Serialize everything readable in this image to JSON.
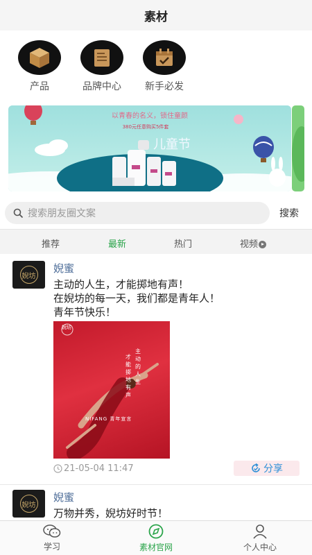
{
  "header": {
    "title": "素材"
  },
  "categories": [
    {
      "label": "产品",
      "icon": "box-icon"
    },
    {
      "label": "品牌中心",
      "icon": "document-icon"
    },
    {
      "label": "新手必发",
      "icon": "calendar-check-icon"
    }
  ],
  "banner": {
    "headline": "以青春的名义，锁住童颜",
    "subline": "380元任意购买5件套",
    "brand": "儿童节"
  },
  "search": {
    "placeholder": "搜索朋友圈文案",
    "button": "搜索"
  },
  "tabs": [
    {
      "label": "推荐",
      "active": false
    },
    {
      "label": "最新",
      "active": true
    },
    {
      "label": "热门",
      "active": false
    },
    {
      "label": "视频",
      "active": false
    }
  ],
  "posts": [
    {
      "author": "婗蜜",
      "avatar_text": "婗坊",
      "lines": [
        "主动的人生，才能掷地有声！",
        "在婗坊的每一天，我们都是青年人！",
        "青年节快乐！"
      ],
      "image": {
        "vertical_text_1": "主动的人生",
        "vertical_text_2": "才能掷地有声",
        "footer": "NIFANG 青年宣言"
      },
      "time": "21-05-04 11:47",
      "share": "分享"
    },
    {
      "author": "婗蜜",
      "avatar_text": "婗坊",
      "lines": [
        "万物并秀，婗坊好时节！"
      ]
    }
  ],
  "bottom_nav": [
    {
      "label": "学习",
      "icon": "wechat-icon",
      "active": false
    },
    {
      "label": "素材官网",
      "icon": "compass-icon",
      "active": true
    },
    {
      "label": "个人中心",
      "icon": "person-icon",
      "active": false
    }
  ],
  "colors": {
    "accent": "#2aa44a",
    "link": "#4a6a96",
    "share": "#2c8fd7"
  }
}
